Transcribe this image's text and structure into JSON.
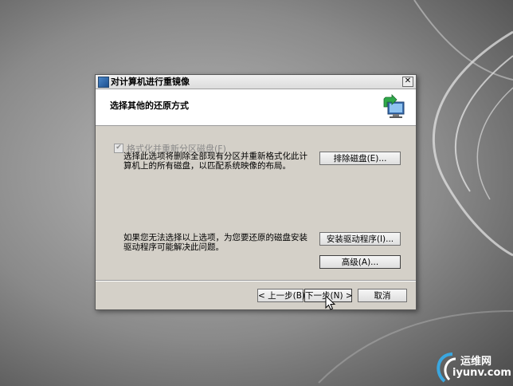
{
  "window": {
    "title": "对计算机进行重镜像",
    "close_glyph": "✕"
  },
  "header": {
    "title": "选择其他的还原方式"
  },
  "options": {
    "format_checkbox_label": "格式化并重新分区磁盘(F)",
    "format_checked": true,
    "format_enabled": false,
    "format_description": "选择此选项将删除全部现有分区并重新格式化此计算机上的所有磁盘，以匹配系统映像的布局。",
    "exclude_button": "排除磁盘(E)...",
    "driver_description": "如果您无法选择以上选项，为您要还原的磁盘安装驱动程序可能解决此问题。",
    "driver_button": "安装驱动程序(I)...",
    "advanced_button": "高级(A)..."
  },
  "footer": {
    "back_button": "< 上一步(B)",
    "next_button": "下一步(N) >",
    "cancel_button": "取消"
  },
  "watermark": {
    "line1": "运维网",
    "line2": "iyunv.com"
  },
  "colors": {
    "dialog_face": "#d4d0c8",
    "header_bg": "#ffffff",
    "disabled_text": "#8a8a8a"
  }
}
